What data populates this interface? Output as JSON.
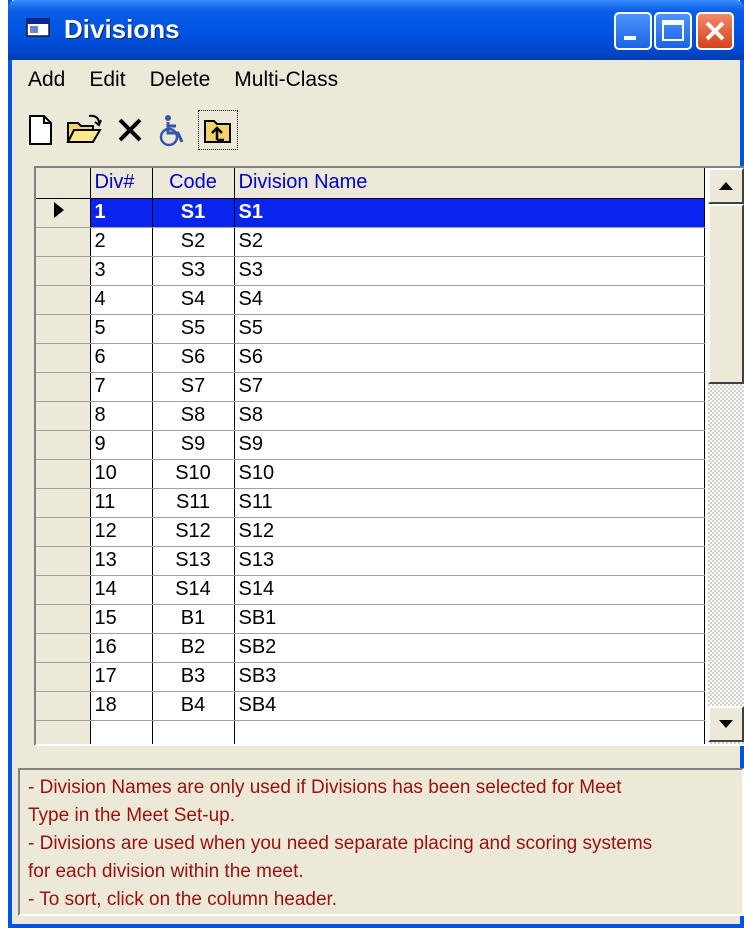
{
  "window": {
    "title": "Divisions",
    "icon": "window-app-icon"
  },
  "menu": [
    "Add",
    "Edit",
    "Delete",
    "Multi-Class"
  ],
  "toolbar": {
    "buttons": [
      {
        "name": "new-icon"
      },
      {
        "name": "open-folder-icon"
      },
      {
        "name": "delete-x-icon"
      },
      {
        "name": "wheelchair-icon"
      },
      {
        "name": "folder-up-icon"
      }
    ]
  },
  "grid": {
    "headers": {
      "div": "Div#",
      "code": "Code",
      "name": "Division Name"
    },
    "selected_row": 0,
    "rows": [
      {
        "div": "1",
        "code": "S1",
        "name": "S1"
      },
      {
        "div": "2",
        "code": "S2",
        "name": "S2"
      },
      {
        "div": "3",
        "code": "S3",
        "name": "S3"
      },
      {
        "div": "4",
        "code": "S4",
        "name": "S4"
      },
      {
        "div": "5",
        "code": "S5",
        "name": "S5"
      },
      {
        "div": "6",
        "code": "S6",
        "name": "S6"
      },
      {
        "div": "7",
        "code": "S7",
        "name": "S7"
      },
      {
        "div": "8",
        "code": "S8",
        "name": "S8"
      },
      {
        "div": "9",
        "code": "S9",
        "name": "S9"
      },
      {
        "div": "10",
        "code": "S10",
        "name": "S10"
      },
      {
        "div": "11",
        "code": "S11",
        "name": "S11"
      },
      {
        "div": "12",
        "code": "S12",
        "name": "S12"
      },
      {
        "div": "13",
        "code": "S13",
        "name": "S13"
      },
      {
        "div": "14",
        "code": "S14",
        "name": "S14"
      },
      {
        "div": "15",
        "code": "B1",
        "name": "SB1"
      },
      {
        "div": "16",
        "code": "B2",
        "name": "SB2"
      },
      {
        "div": "17",
        "code": "B3",
        "name": "SB3"
      },
      {
        "div": "18",
        "code": "B4",
        "name": "SB4"
      }
    ]
  },
  "help": {
    "lines": [
      "- Division Names are only used if Divisions has been selected for Meet",
      "Type in the Meet Set-up.",
      "- Divisions are used when you need separate placing and scoring systems",
      "for each division within the meet.",
      "- To sort, click on the column header."
    ]
  },
  "colors": {
    "title_bar": "#0054e3",
    "selection": "#0a24f0",
    "header_text": "#0000cc",
    "help_text": "#9a1010"
  }
}
